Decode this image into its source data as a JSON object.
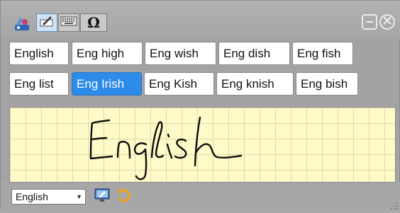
{
  "toolbar": {
    "buttons": [
      {
        "name": "app-logo",
        "icon": "paint-tray-icon"
      },
      {
        "name": "handwriting-mode",
        "icon": "pen-on-paper-icon",
        "active": true
      },
      {
        "name": "keyboard-mode",
        "icon": "keyboard-icon",
        "active": false
      },
      {
        "name": "symbols-mode",
        "icon": "omega-icon",
        "label": "Ω",
        "active": false
      }
    ],
    "window": {
      "minimize_icon": "minus-icon",
      "close_icon": "close-icon"
    }
  },
  "candidates": {
    "row1": [
      "English",
      "Eng high",
      "Eng wish",
      "Eng dish",
      "Eng fish"
    ],
    "row2": [
      "Eng list",
      "Eng Irish",
      "Eng Kish",
      "Eng knish",
      "Eng bish"
    ],
    "selected": "Eng Irish"
  },
  "ink": {
    "recognized_stroke": "English"
  },
  "statusbar": {
    "language": "English",
    "icons": [
      "monitor-icon",
      "undo-swirl-icon"
    ]
  },
  "colors": {
    "accent": "#2d8bea",
    "ink_bg": "#fffbc9",
    "panel": "#a3a3a3"
  }
}
